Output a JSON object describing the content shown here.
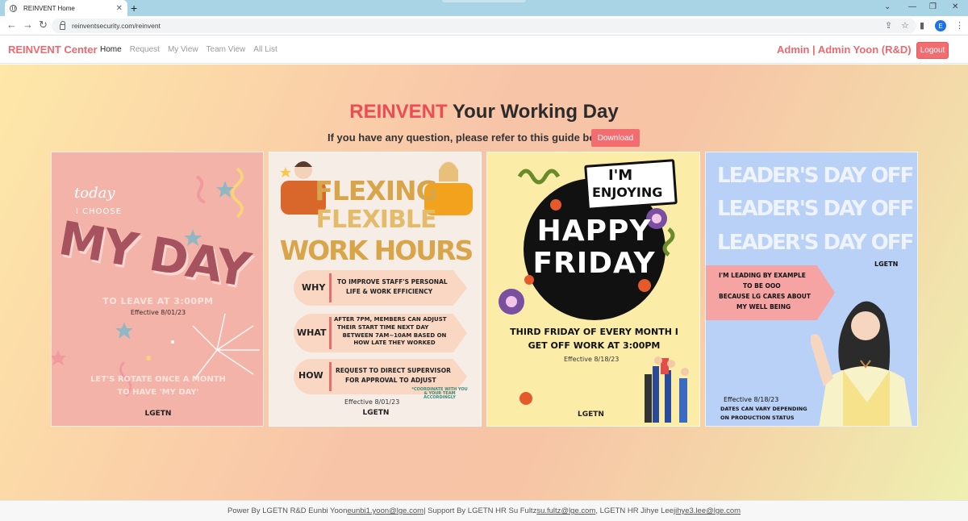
{
  "browser": {
    "tab_title": "REINVENT Home",
    "tab_close": "✕",
    "new_tab": "+",
    "url": "reinventsecurity.com/reinvent",
    "profile_initial": "E"
  },
  "app": {
    "brand": "REINVENT Center",
    "nav": [
      {
        "label": "Home",
        "active": true
      },
      {
        "label": "Request"
      },
      {
        "label": "My View"
      },
      {
        "label": "Team View"
      },
      {
        "label": "All List"
      }
    ],
    "user_label": "Admin | Admin Yoon (R&D)",
    "logout_label": "Logout"
  },
  "hero": {
    "title_accent": "REINVENT",
    "title_rest": " Your Working Day",
    "subtitle": "If you have any question, please refer to this guide book!",
    "download_label": "Download"
  },
  "cards": {
    "my_day": {
      "script_1": "today",
      "script_2": "I CHOOSE",
      "title": "MY DAY",
      "leave": "TO LEAVE AT 3:00PM",
      "effective": "Effective 8/01/23",
      "rotate_1": "LET'S ROTATE ONCE A MONTH",
      "rotate_2": "TO HAVE 'MY DAY'",
      "logo": "LGETN"
    },
    "flex": {
      "title_1": "FLEXING",
      "title_2": "FLEXIBLE",
      "title_3": "WORK HOURS",
      "rows": [
        {
          "key": "WHY",
          "text_1": "TO IMPROVE STAFF'S PERSONAL",
          "text_2": "LIFE & WORK EFFICIENCY",
          "text_3": ""
        },
        {
          "key": "WHAT",
          "text_1": "AFTER 7PM, MEMBERS CAN ADJUST",
          "text_2": "THEIR START TIME NEXT DAY",
          "text_3": "BETWEEN 7AM~10AM BASED ON HOW LATE THEY WORKED"
        },
        {
          "key": "HOW",
          "text_1": "REQUEST TO DIRECT SUPERVISOR",
          "text_2": "FOR APPROVAL TO ADJUST",
          "text_3": ""
        }
      ],
      "note": "*COORDINATE WITH YOU & YOUR TEAM ACCORDINGLY",
      "effective": "Effective 8/01/23",
      "logo": "LGETN"
    },
    "friday": {
      "bubble_1": "I'M",
      "bubble_2": "ENJOYING",
      "title_1": "HAPPY",
      "title_2": "FRIDAY",
      "desc_1": "THIRD FRIDAY OF EVERY MONTH I",
      "desc_2": "GET OFF WORK AT 3:00PM",
      "effective": "Effective 8/18/23",
      "logo": "LGETN"
    },
    "leader": {
      "title": "LEADER'S DAY OFF",
      "logo": "LGETN",
      "banner_1": "I'M LEADING BY EXAMPLE",
      "banner_2": "TO BE OOO",
      "banner_3": "BECAUSE LG CARES ABOUT",
      "banner_4": "MY WELL BEING",
      "effective": "Effective 8/18/23",
      "note_1": "DATES CAN VARY DEPENDING",
      "note_2": "ON PRODUCTION STATUS"
    }
  },
  "footer": {
    "text_1": "Power By LGETN R&D Eunbi Yoon ",
    "email_1": "eunbi1.yoon@lge.com",
    "text_2": " | Support By LGETN HR Su Fultz ",
    "email_2": "su.fultz@lge.com",
    "text_3": ", LGETN HR Jihye Lee ",
    "email_3": "jihye3.lee@lge.com"
  },
  "colors": {
    "accent": "#f0686e",
    "button": "#f36c6f"
  }
}
